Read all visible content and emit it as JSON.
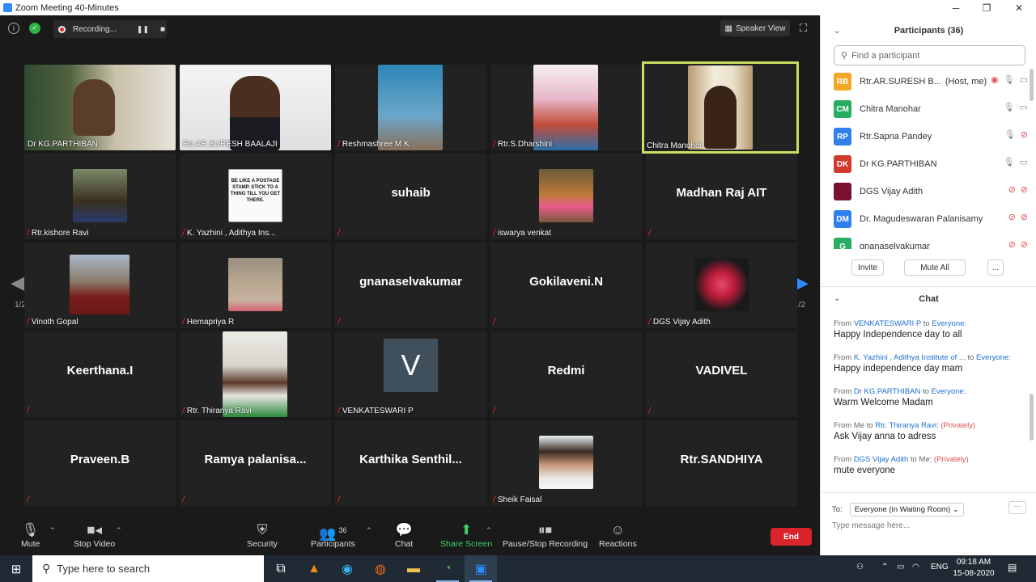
{
  "window": {
    "title": "Zoom Meeting 40-Minutes",
    "minimize": "─",
    "maximize": "❐",
    "close": "✕"
  },
  "topbar": {
    "recording_label": "Recording...",
    "pause": "❚❚",
    "stop": "■",
    "speaker_view": "Speaker View",
    "fullscreen": "⛶"
  },
  "paging": {
    "left_page": "1/2",
    "right_page": "1/2"
  },
  "tiles": [
    {
      "name": "Dr KG.PARTHIBAN",
      "big": "",
      "muted": false
    },
    {
      "name": "Rtr.AR.SURESH BAALAJI",
      "big": "",
      "muted": false
    },
    {
      "name": "Reshmashree M K",
      "big": "",
      "muted": true
    },
    {
      "name": "Rtr.S.Dharshini",
      "big": "",
      "muted": true
    },
    {
      "name": "Chitra Manohar",
      "big": "",
      "muted": false
    },
    {
      "name": "Rtr.kishore Ravi",
      "big": "",
      "muted": true
    },
    {
      "name": "K. Yazhini , Adithya Ins...",
      "big": "",
      "muted": true
    },
    {
      "name": "",
      "big": "suhaib",
      "muted": true
    },
    {
      "name": "iswarya venkat",
      "big": "",
      "muted": true
    },
    {
      "name": "",
      "big": "Madhan Raj AIT",
      "muted": true
    },
    {
      "name": "Vinoth Gopal",
      "big": "",
      "muted": true
    },
    {
      "name": "Hemapriya R",
      "big": "",
      "muted": true
    },
    {
      "name": "",
      "big": "gnanaselvakumar",
      "muted": true
    },
    {
      "name": "",
      "big": "Gokilaveni.N",
      "muted": true
    },
    {
      "name": "DGS Vijay Adith",
      "big": "",
      "muted": true
    },
    {
      "name": "",
      "big": "Keerthana.I",
      "muted": true
    },
    {
      "name": "Rtr. Thiranya Ravi",
      "big": "",
      "muted": true
    },
    {
      "name": "VENKATESWARI P",
      "big": "",
      "muted": true,
      "initial": "V"
    },
    {
      "name": "",
      "big": "Redmi",
      "muted": true
    },
    {
      "name": "",
      "big": "VADIVEL",
      "muted": true
    },
    {
      "name": "",
      "big": "Praveen.B",
      "muted": true
    },
    {
      "name": "",
      "big": "Ramya  palanisa...",
      "muted": true
    },
    {
      "name": "",
      "big": "Karthika  Senthil...",
      "muted": true
    },
    {
      "name": "Sheik Faisal",
      "big": "",
      "muted": true
    },
    {
      "name": "",
      "big": "Rtr.SANDHIYA",
      "muted": true
    }
  ],
  "toolbar": {
    "mute": "Mute",
    "stop_video": "Stop Video",
    "security": "Security",
    "participants": "Participants",
    "participants_count": "36",
    "chat": "Chat",
    "share_screen": "Share Screen",
    "pause_stop_recording": "Pause/Stop Recording",
    "reactions": "Reactions",
    "end": "End"
  },
  "participants_panel": {
    "title": "Participants (36)",
    "search_placeholder": "Find a participant",
    "rows": [
      {
        "initials": "RB",
        "color": "#f5a623",
        "name": "Rtr.AR.SURESH B...",
        "tag": "(Host, me)"
      },
      {
        "initials": "CM",
        "color": "#27ae60",
        "name": "Chitra Manohar",
        "tag": ""
      },
      {
        "initials": "RP",
        "color": "#2f80ed",
        "name": "Rtr.Sapna Pandey",
        "tag": ""
      },
      {
        "initials": "DK",
        "color": "#d0392b",
        "name": "Dr KG.PARTHIBAN",
        "tag": ""
      },
      {
        "initials": "",
        "color": "#7a1030",
        "name": "DGS Vijay Adith",
        "tag": ""
      },
      {
        "initials": "DM",
        "color": "#2f80ed",
        "name": "Dr. Magudeswaran Palanisamy",
        "tag": ""
      },
      {
        "initials": "G",
        "color": "#27ae60",
        "name": "gnanaselvakumar",
        "tag": ""
      }
    ],
    "invite": "Invite",
    "mute_all": "Mute All",
    "more": "..."
  },
  "chat_panel": {
    "title": "Chat",
    "messages": [
      {
        "from_word": "From",
        "from": "VENKATESWARI P",
        "to_word": "to",
        "to": "Everyone:",
        "private": "",
        "text": "Happy Independence day to all"
      },
      {
        "from_word": "From",
        "from": "K. Yazhini , Adithya Institute of ...",
        "to_word": "to",
        "to": "Everyone:",
        "private": "",
        "text": "Happy independence day mam"
      },
      {
        "from_word": "From",
        "from": "Dr KG.PARTHIBAN",
        "to_word": "to",
        "to": "Everyone:",
        "private": "",
        "text": "Warm Welcome Madam"
      },
      {
        "from_word": "From Me",
        "from": "",
        "to_word": "to",
        "to": "Rtr. Thiranya Ravi:",
        "private": "(Privately)",
        "text": "Ask Vijay anna to adress"
      },
      {
        "from_word": "From",
        "from": "DGS Vijay Adith",
        "to_word": "to Me:",
        "to": "",
        "private": "(Privately)",
        "text": "mute everyone"
      }
    ],
    "to_label": "To:",
    "to_value": "Everyone (in Waiting Room)",
    "more": "···",
    "input_placeholder": "Type message here..."
  },
  "taskbar": {
    "search_placeholder": "Type here to search",
    "lang": "ENG",
    "time": "09:18 AM",
    "date": "15-08-2020"
  }
}
